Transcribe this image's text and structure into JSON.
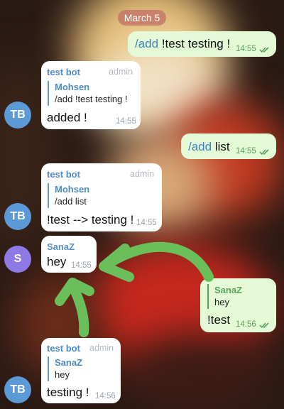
{
  "date_label": "March 5",
  "colors": {
    "avatar_tb": "#5b9ad6",
    "avatar_s": "#8d7ae6",
    "arrow": "#6bbf5b"
  },
  "messages": {
    "m1": {
      "cmd": "/add",
      "rest": " !test testing !",
      "time": "14:55"
    },
    "m2": {
      "sender": "test bot",
      "badge": "admin",
      "reply_author": "Mohsen",
      "reply_text": "/add !test testing !",
      "text": "added !",
      "time": "14:55"
    },
    "m3": {
      "cmd": "/add",
      "rest": " list",
      "time": "14:55"
    },
    "m4": {
      "sender": "test bot",
      "badge": "admin",
      "reply_author": "Mohsen",
      "reply_text": "/add list",
      "text": "!test --> testing !",
      "time": "14:55"
    },
    "m5": {
      "sender": "SanaZ",
      "text": "hey",
      "time": "14:55"
    },
    "m6": {
      "reply_author": "SanaZ",
      "reply_text": "hey",
      "text": "!test",
      "time": "14:56"
    },
    "m7": {
      "sender": "test bot",
      "badge": "admin",
      "reply_author": "SanaZ",
      "reply_text": "hey",
      "text": "testing !",
      "time": "14:56"
    }
  },
  "avatars": {
    "tb": "TB",
    "s": "S"
  }
}
